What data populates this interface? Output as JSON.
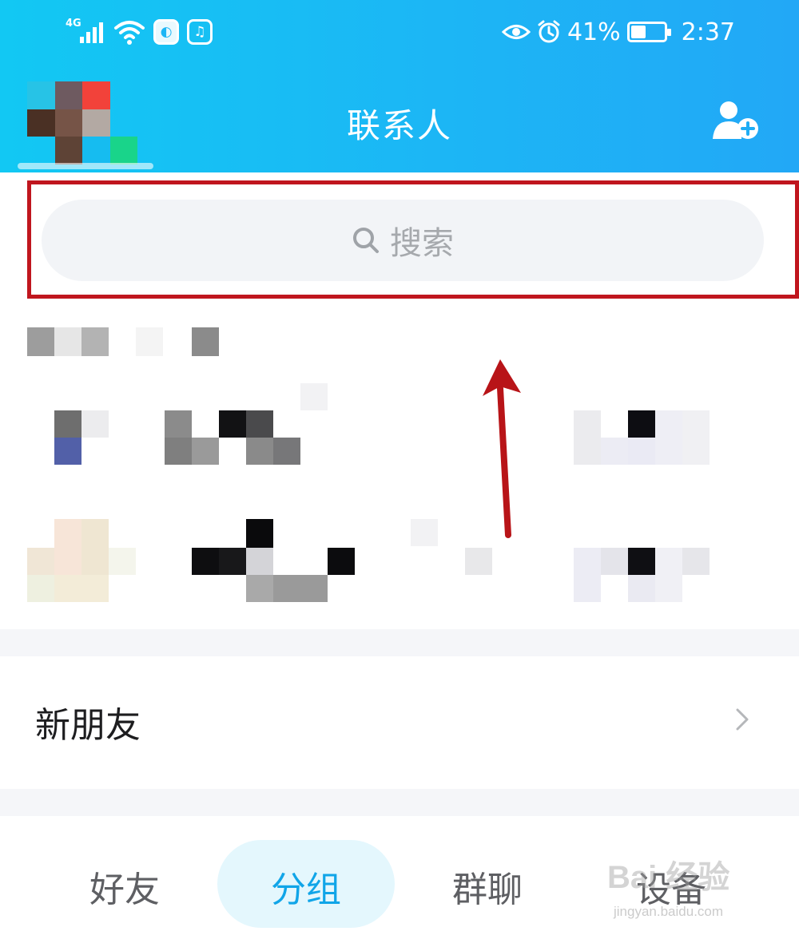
{
  "status_bar": {
    "network": "4G",
    "battery": "41%",
    "time": "2:37"
  },
  "header": {
    "title": "联系人"
  },
  "search": {
    "placeholder": "搜索"
  },
  "list": {
    "new_friends_label": "新朋友"
  },
  "tabs": [
    {
      "label": "好友",
      "active": false
    },
    {
      "label": "分组",
      "active": true
    },
    {
      "label": "群聊",
      "active": false
    },
    {
      "label": "设备",
      "active": false
    }
  ],
  "watermark": {
    "brand": "Bai 经验",
    "url": "jingyan.baidu.com"
  },
  "colors": {
    "header_gradient_start": "#12c8f3",
    "header_gradient_end": "#22a8f6",
    "annotation_red": "#c0161e",
    "tab_active": "#10a5e8"
  }
}
